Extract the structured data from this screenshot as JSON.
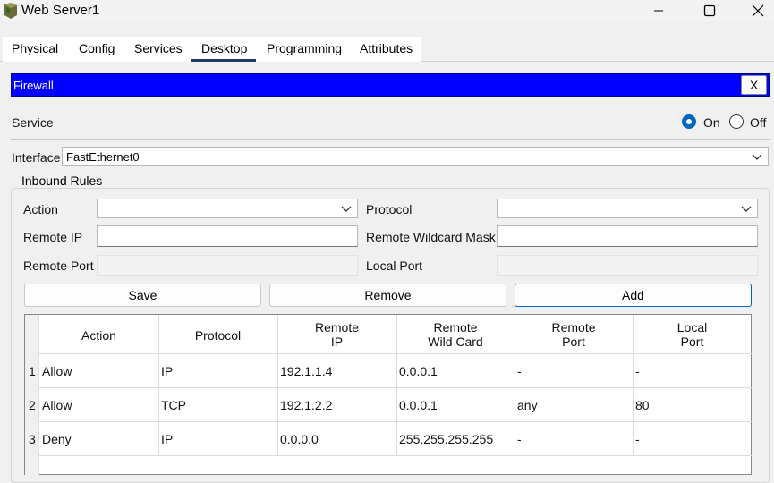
{
  "window": {
    "title": "Web Server1",
    "controls": {
      "minimize": "minimize-icon",
      "maximize": "maximize-icon",
      "close": "close-icon"
    }
  },
  "tabs": [
    "Physical",
    "Config",
    "Services",
    "Desktop",
    "Programming",
    "Attributes"
  ],
  "active_tab": "Desktop",
  "firewall": {
    "header": "Firewall",
    "close_label": "X",
    "service": {
      "label": "Service",
      "on_label": "On",
      "off_label": "Off",
      "selected": "On"
    },
    "interface": {
      "label": "Interface",
      "value": "FastEthernet0"
    },
    "inbound": {
      "legend": "Inbound Rules",
      "action_label": "Action",
      "action_value": "",
      "protocol_label": "Protocol",
      "protocol_value": "",
      "remote_ip_label": "Remote IP",
      "remote_ip_value": "",
      "wildcard_label": "Remote Wildcard Mask",
      "wildcard_value": "",
      "remote_port_label": "Remote Port",
      "local_port_label": "Local Port",
      "buttons": {
        "save": "Save",
        "remove": "Remove",
        "add": "Add"
      }
    },
    "table": {
      "headers": [
        [
          "Action"
        ],
        [
          "Protocol"
        ],
        [
          "Remote",
          "IP"
        ],
        [
          "Remote",
          "Wild Card"
        ],
        [
          "Remote",
          "Port"
        ],
        [
          "Local",
          "Port"
        ]
      ],
      "rows": [
        {
          "num": "1",
          "action": "Allow",
          "protocol": "IP",
          "remote_ip": "192.1.1.4",
          "wildcard": "0.0.0.1",
          "remote_port": "-",
          "local_port": "-"
        },
        {
          "num": "2",
          "action": "Allow",
          "protocol": "TCP",
          "remote_ip": "192.1.2.2",
          "wildcard": "0.0.0.1",
          "remote_port": "any",
          "local_port": "80"
        },
        {
          "num": "3",
          "action": "Deny",
          "protocol": "IP",
          "remote_ip": "0.0.0.0",
          "wildcard": "255.255.255.255",
          "remote_port": "-",
          "local_port": "-"
        }
      ]
    }
  },
  "colors": {
    "header_blue": "#0000ff",
    "accent": "#0067c0"
  }
}
